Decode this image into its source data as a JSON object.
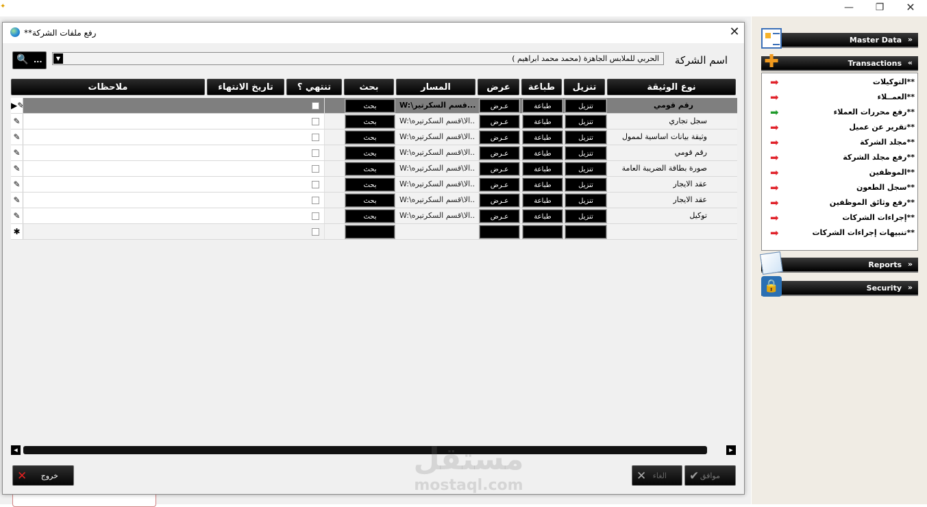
{
  "window": {
    "minimize": "—",
    "maximize": "❐",
    "close": "✕"
  },
  "dialog": {
    "title": "**رفع ملفات الشركة",
    "close": "✕",
    "search_button_label": "...",
    "company_label": "اسم الشركة",
    "company_value": "الحربي للملابس الجاهزة (محمد محمد ابراهيم )",
    "columns": {
      "doc_type": "نوع الوثيقة",
      "download": "تنزيل",
      "print": "طباعة",
      "view": "عرض",
      "path": "المسار",
      "search": "بحث",
      "ends": "تنتهي ؟",
      "end_date": "تاريخ الانتهاء",
      "notes": "ملاحظات"
    },
    "rows": [
      {
        "doc_type": "رقم قومي",
        "path": "W:\\قسم السكرتير...",
        "download": "تنزيل",
        "print": "طباعة",
        "view": "عـرض",
        "search": "بحث",
        "selector": "▶✎"
      },
      {
        "doc_type": "سجل تجاري",
        "path": "W:\\الا\\قسم السكرتيره...",
        "download": "تنزيل",
        "print": "طباعة",
        "view": "عـرض",
        "search": "بحث",
        "selector": "✎"
      },
      {
        "doc_type": "وثيقة بيانات اساسية لممول",
        "path": "W:\\الا\\قسم السكرتيره...",
        "download": "تنزيل",
        "print": "طباعة",
        "view": "عـرض",
        "search": "بحث",
        "selector": "✎"
      },
      {
        "doc_type": "رقم قومي",
        "path": "W:\\الا\\قسم السكرتيره...",
        "download": "تنزيل",
        "print": "طباعة",
        "view": "عـرض",
        "search": "بحث",
        "selector": "✎"
      },
      {
        "doc_type": "صورة بطاقة الضريبة العامة",
        "path": "W:\\الا\\قسم السكرتيره...",
        "download": "تنزيل",
        "print": "طباعة",
        "view": "عـرض",
        "search": "بحث",
        "selector": "✎"
      },
      {
        "doc_type": "عقد الايجار",
        "path": "W:\\الا\\قسم السكرتيره...",
        "download": "تنزيل",
        "print": "طباعة",
        "view": "عـرض",
        "search": "بحث",
        "selector": "✎"
      },
      {
        "doc_type": "عقد الايجار",
        "path": "W:\\الا\\قسم السكرتيره...",
        "download": "تنزيل",
        "print": "طباعة",
        "view": "عـرض",
        "search": "بحث",
        "selector": "✎"
      },
      {
        "doc_type": "توكيل",
        "path": "W:\\الا\\قسم السكرتيره...",
        "download": "تنزيل",
        "print": "طباعة",
        "view": "عـرض",
        "search": "بحث",
        "selector": "✎"
      }
    ],
    "new_row_selector": "✱",
    "exit_label": "خروج",
    "cancel_label": "الغاء",
    "ok_label": "موافق"
  },
  "watermark": {
    "arabic": "مستقل",
    "latin": "mostaql.com"
  },
  "nav": {
    "sections": {
      "master_data": "Master Data",
      "transactions": "Transactions",
      "reports": "Reports",
      "security": "Security"
    },
    "transactions_items": [
      {
        "label": "**التوكيلات",
        "arrow": "red"
      },
      {
        "label": "**العمــلاء",
        "arrow": "red"
      },
      {
        "label": "**رفع محررات العملاء",
        "arrow": "green"
      },
      {
        "label": "**تقرير عن عميل",
        "arrow": "red"
      },
      {
        "label": "**مجلد الشركة",
        "arrow": "red"
      },
      {
        "label": "**رفع مجلد الشركة",
        "arrow": "red"
      },
      {
        "label": "**الموظفين",
        "arrow": "red"
      },
      {
        "label": "**سجل الطعون",
        "arrow": "red"
      },
      {
        "label": "**رفع وثائق الموظفين",
        "arrow": "red"
      },
      {
        "label": "**إجراءات الشركات",
        "arrow": "red"
      },
      {
        "label": "**تنبيهات إجراءات الشركات",
        "arrow": "red"
      }
    ]
  },
  "colors": {
    "header_black": "#000000",
    "selected_row": "#7f7f7f",
    "arrow_red": "#e0222a",
    "arrow_green": "#1e9a2a"
  }
}
